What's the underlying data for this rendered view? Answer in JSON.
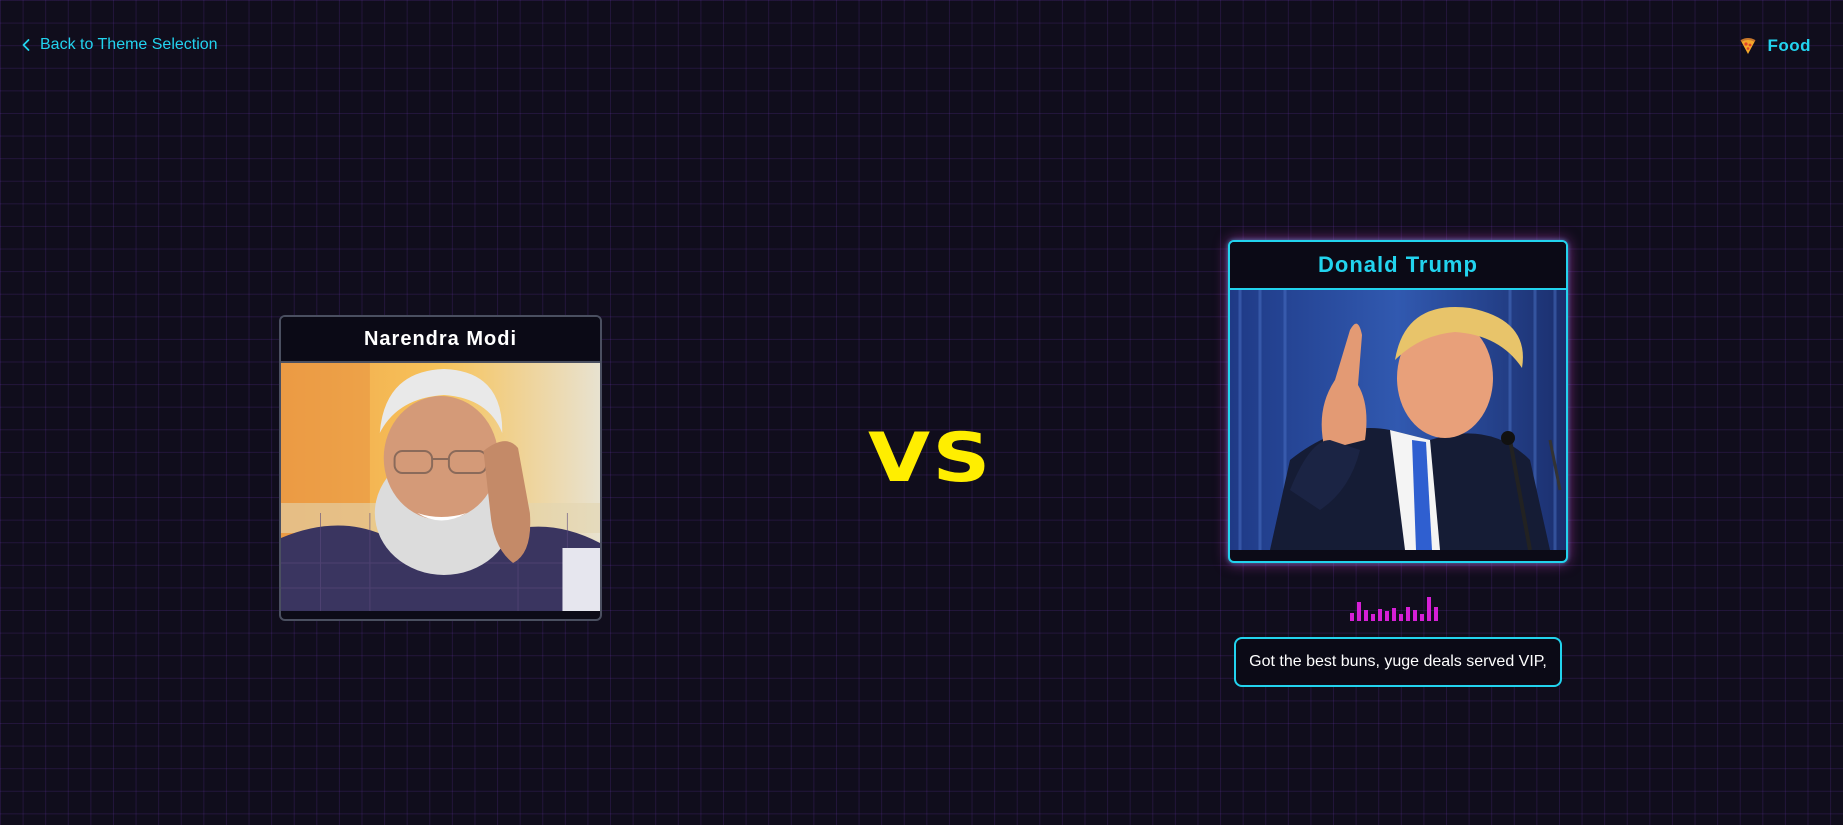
{
  "nav": {
    "back_label": "Back to Theme Selection",
    "theme_label": "Food",
    "theme_icon": "pizza-icon"
  },
  "battle": {
    "left": {
      "name": "Narendra Modi",
      "image_alt": "Narendra Modi"
    },
    "vs_label": "VS",
    "right": {
      "name": "Donald Trump",
      "image_alt": "Donald Trump",
      "active": true,
      "lyric": "Got the best buns, yuge deals served VIP,"
    },
    "visualizer_levels": [
      0.35,
      0.8,
      0.45,
      0.3,
      0.5,
      0.4,
      0.55,
      0.3,
      0.6,
      0.45,
      0.3,
      1.0,
      0.6
    ]
  },
  "colors": {
    "accent_cyan": "#22d3ee",
    "accent_magenta": "#d61fd6",
    "vs_yellow": "#ffee00",
    "background": "#100d1c"
  }
}
